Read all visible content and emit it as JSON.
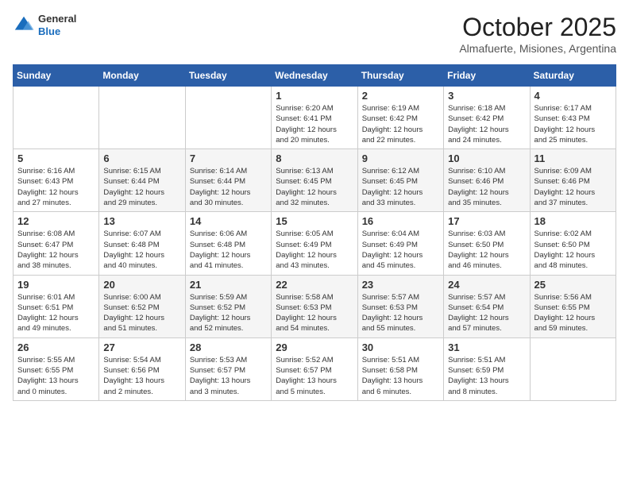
{
  "header": {
    "logo": {
      "general": "General",
      "blue": "Blue"
    },
    "month": "October 2025",
    "location": "Almafuerte, Misiones, Argentina"
  },
  "days_header": [
    "Sunday",
    "Monday",
    "Tuesday",
    "Wednesday",
    "Thursday",
    "Friday",
    "Saturday"
  ],
  "weeks": [
    [
      {
        "num": "",
        "info": ""
      },
      {
        "num": "",
        "info": ""
      },
      {
        "num": "",
        "info": ""
      },
      {
        "num": "1",
        "info": "Sunrise: 6:20 AM\nSunset: 6:41 PM\nDaylight: 12 hours\nand 20 minutes."
      },
      {
        "num": "2",
        "info": "Sunrise: 6:19 AM\nSunset: 6:42 PM\nDaylight: 12 hours\nand 22 minutes."
      },
      {
        "num": "3",
        "info": "Sunrise: 6:18 AM\nSunset: 6:42 PM\nDaylight: 12 hours\nand 24 minutes."
      },
      {
        "num": "4",
        "info": "Sunrise: 6:17 AM\nSunset: 6:43 PM\nDaylight: 12 hours\nand 25 minutes."
      }
    ],
    [
      {
        "num": "5",
        "info": "Sunrise: 6:16 AM\nSunset: 6:43 PM\nDaylight: 12 hours\nand 27 minutes."
      },
      {
        "num": "6",
        "info": "Sunrise: 6:15 AM\nSunset: 6:44 PM\nDaylight: 12 hours\nand 29 minutes."
      },
      {
        "num": "7",
        "info": "Sunrise: 6:14 AM\nSunset: 6:44 PM\nDaylight: 12 hours\nand 30 minutes."
      },
      {
        "num": "8",
        "info": "Sunrise: 6:13 AM\nSunset: 6:45 PM\nDaylight: 12 hours\nand 32 minutes."
      },
      {
        "num": "9",
        "info": "Sunrise: 6:12 AM\nSunset: 6:45 PM\nDaylight: 12 hours\nand 33 minutes."
      },
      {
        "num": "10",
        "info": "Sunrise: 6:10 AM\nSunset: 6:46 PM\nDaylight: 12 hours\nand 35 minutes."
      },
      {
        "num": "11",
        "info": "Sunrise: 6:09 AM\nSunset: 6:46 PM\nDaylight: 12 hours\nand 37 minutes."
      }
    ],
    [
      {
        "num": "12",
        "info": "Sunrise: 6:08 AM\nSunset: 6:47 PM\nDaylight: 12 hours\nand 38 minutes."
      },
      {
        "num": "13",
        "info": "Sunrise: 6:07 AM\nSunset: 6:48 PM\nDaylight: 12 hours\nand 40 minutes."
      },
      {
        "num": "14",
        "info": "Sunrise: 6:06 AM\nSunset: 6:48 PM\nDaylight: 12 hours\nand 41 minutes."
      },
      {
        "num": "15",
        "info": "Sunrise: 6:05 AM\nSunset: 6:49 PM\nDaylight: 12 hours\nand 43 minutes."
      },
      {
        "num": "16",
        "info": "Sunrise: 6:04 AM\nSunset: 6:49 PM\nDaylight: 12 hours\nand 45 minutes."
      },
      {
        "num": "17",
        "info": "Sunrise: 6:03 AM\nSunset: 6:50 PM\nDaylight: 12 hours\nand 46 minutes."
      },
      {
        "num": "18",
        "info": "Sunrise: 6:02 AM\nSunset: 6:50 PM\nDaylight: 12 hours\nand 48 minutes."
      }
    ],
    [
      {
        "num": "19",
        "info": "Sunrise: 6:01 AM\nSunset: 6:51 PM\nDaylight: 12 hours\nand 49 minutes."
      },
      {
        "num": "20",
        "info": "Sunrise: 6:00 AM\nSunset: 6:52 PM\nDaylight: 12 hours\nand 51 minutes."
      },
      {
        "num": "21",
        "info": "Sunrise: 5:59 AM\nSunset: 6:52 PM\nDaylight: 12 hours\nand 52 minutes."
      },
      {
        "num": "22",
        "info": "Sunrise: 5:58 AM\nSunset: 6:53 PM\nDaylight: 12 hours\nand 54 minutes."
      },
      {
        "num": "23",
        "info": "Sunrise: 5:57 AM\nSunset: 6:53 PM\nDaylight: 12 hours\nand 55 minutes."
      },
      {
        "num": "24",
        "info": "Sunrise: 5:57 AM\nSunset: 6:54 PM\nDaylight: 12 hours\nand 57 minutes."
      },
      {
        "num": "25",
        "info": "Sunrise: 5:56 AM\nSunset: 6:55 PM\nDaylight: 12 hours\nand 59 minutes."
      }
    ],
    [
      {
        "num": "26",
        "info": "Sunrise: 5:55 AM\nSunset: 6:55 PM\nDaylight: 13 hours\nand 0 minutes."
      },
      {
        "num": "27",
        "info": "Sunrise: 5:54 AM\nSunset: 6:56 PM\nDaylight: 13 hours\nand 2 minutes."
      },
      {
        "num": "28",
        "info": "Sunrise: 5:53 AM\nSunset: 6:57 PM\nDaylight: 13 hours\nand 3 minutes."
      },
      {
        "num": "29",
        "info": "Sunrise: 5:52 AM\nSunset: 6:57 PM\nDaylight: 13 hours\nand 5 minutes."
      },
      {
        "num": "30",
        "info": "Sunrise: 5:51 AM\nSunset: 6:58 PM\nDaylight: 13 hours\nand 6 minutes."
      },
      {
        "num": "31",
        "info": "Sunrise: 5:51 AM\nSunset: 6:59 PM\nDaylight: 13 hours\nand 8 minutes."
      },
      {
        "num": "",
        "info": ""
      }
    ]
  ]
}
